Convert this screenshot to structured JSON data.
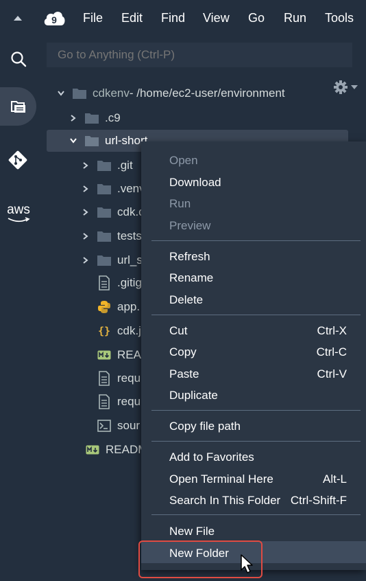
{
  "menubar": {
    "items": [
      "File",
      "Edit",
      "Find",
      "View",
      "Go",
      "Run",
      "Tools"
    ]
  },
  "rail": {
    "aws_label": "aws"
  },
  "search": {
    "placeholder": "Go to Anything (Ctrl-P)"
  },
  "tree": {
    "root_name": "cdkenv",
    "root_path": " - /home/ec2-user/environment",
    "items": [
      {
        "label": ".c9"
      },
      {
        "label": "url-short"
      },
      {
        "label": ".git"
      },
      {
        "label": ".venv"
      },
      {
        "label": "cdk.c"
      },
      {
        "label": "tests"
      },
      {
        "label": "url_s"
      },
      {
        "label": ".gitig"
      },
      {
        "label": "app."
      },
      {
        "label": "cdk.j"
      },
      {
        "label": "REA"
      },
      {
        "label": "requ"
      },
      {
        "label": "requ"
      },
      {
        "label": "sour"
      },
      {
        "label": "READM"
      }
    ]
  },
  "context_menu": {
    "open": "Open",
    "download": "Download",
    "run": "Run",
    "preview": "Preview",
    "refresh": "Refresh",
    "rename": "Rename",
    "delete": "Delete",
    "cut": "Cut",
    "cut_sc": "Ctrl-X",
    "copy": "Copy",
    "copy_sc": "Ctrl-C",
    "paste": "Paste",
    "paste_sc": "Ctrl-V",
    "duplicate": "Duplicate",
    "copy_path": "Copy file path",
    "add_fav": "Add to Favorites",
    "open_terminal": "Open Terminal Here",
    "open_terminal_sc": "Alt-L",
    "search_folder": "Search In This Folder",
    "search_folder_sc": "Ctrl-Shift-F",
    "new_file": "New File",
    "new_folder": "New Folder"
  },
  "colors": {
    "background": "#232f3e",
    "menu_background": "#2b3644",
    "highlight": "#e04b42",
    "python": "#f0b429",
    "json": "#e3b341",
    "markdown": "#a8c77a"
  }
}
